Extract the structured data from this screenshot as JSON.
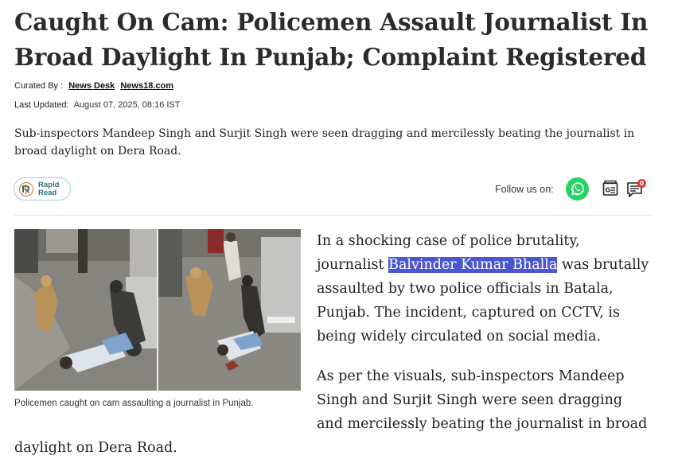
{
  "article": {
    "headline": "Caught On Cam: Policemen Assault Journalist In Broad Daylight In Punjab; Complaint Registered",
    "curated_label": "Curated By :",
    "authors": [
      "News Desk",
      "News18.com"
    ],
    "updated_label": "Last Updated:",
    "updated_date": "August 07, 2025, 08:16 IST",
    "summary": "Sub-inspectors Mandeep Singh and Surjit Singh were seen dragging and mercilessly beating the journalist in broad daylight on Dera Road."
  },
  "toolbar": {
    "rapid_read_line1": "Rapid",
    "rapid_read_line2": "Read",
    "follow_label": "Follow us on:",
    "comment_count": "0",
    "gnews_icon": "google-news-icon",
    "whatsapp_color": "#25d366",
    "badge_color": "#e8322f"
  },
  "image": {
    "caption": "Policemen caught on cam assaulting a journalist in Punjab."
  },
  "body": {
    "p1_before": "In a shocking case of police brutality, journalist ",
    "p1_highlight": "Balvinder Kumar Bhalla",
    "p1_after": " was brutally assaulted by two police officials in Batala, Punjab. The incident, captured on CCTV, is being widely circulated on social media.",
    "p2_main": "As per the visuals, sub-inspectors Mandeep Singh and Surjit Singh were seen dragging and mercilessly beating the journalist in broad",
    "p2_tail": "daylight on Dera Road.",
    "highlight_color": "#4b57d1"
  }
}
